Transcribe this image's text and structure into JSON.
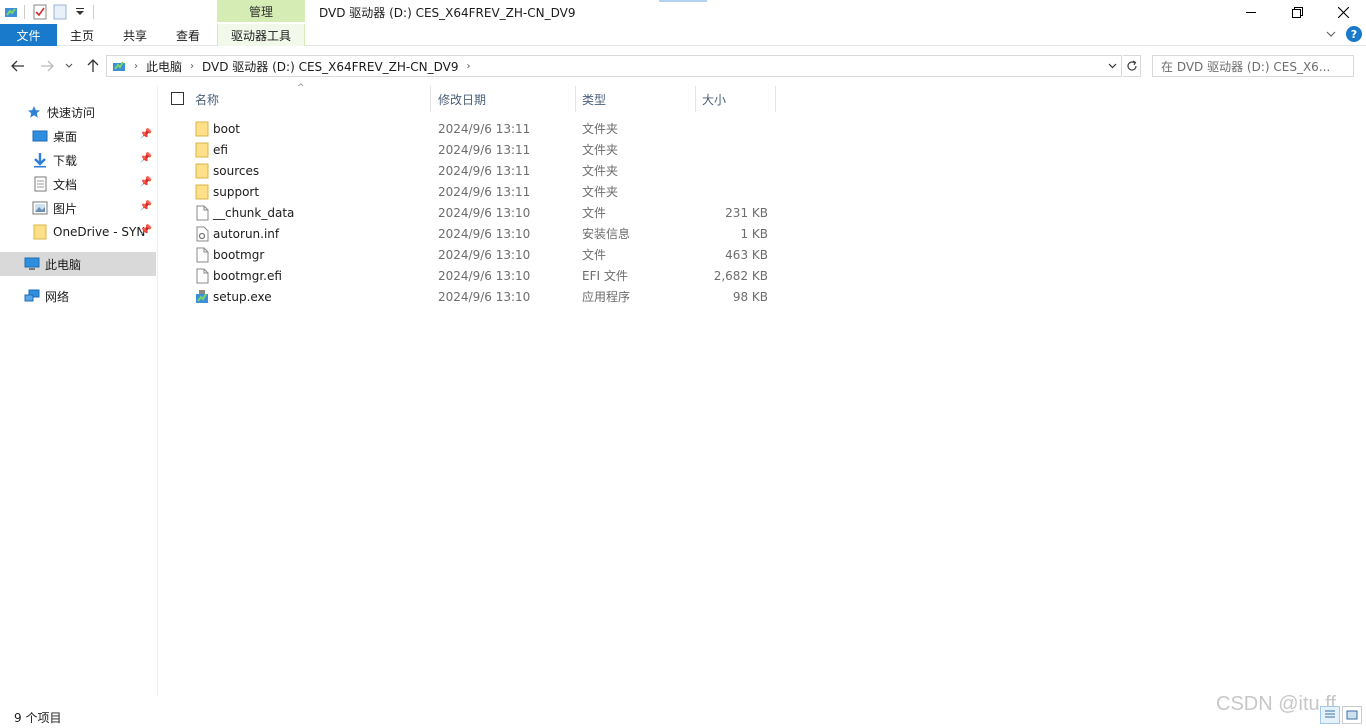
{
  "window": {
    "title": "DVD 驱动器 (D:) CES_X64FREV_ZH-CN_DV9",
    "contextual_tab_group": "管理",
    "controls": {
      "minimize": "—",
      "maximize": "❐",
      "close": "✕"
    }
  },
  "quick_access_toolbar": {
    "items": [
      "properties-icon",
      "checklist-icon",
      "new-folder-icon",
      "customize-dropdown-icon"
    ]
  },
  "ribbon": {
    "tabs": [
      {
        "label": "文件",
        "active": true
      },
      {
        "label": "主页"
      },
      {
        "label": "共享"
      },
      {
        "label": "查看"
      },
      {
        "label": "驱动器工具",
        "contextual": true
      }
    ],
    "accent_color": "#1979ca",
    "contextual_color": "#d6ecb5"
  },
  "address_bar": {
    "breadcrumbs": [
      "此电脑",
      "DVD 驱动器 (D:) CES_X64FREV_ZH-CN_DV9"
    ],
    "search_placeholder": "在 DVD 驱动器 (D:) CES_X6..."
  },
  "nav_pane": {
    "items": [
      {
        "label": "快速访问",
        "icon": "star-icon"
      },
      {
        "label": "桌面",
        "icon": "desktop-icon",
        "pinned": true
      },
      {
        "label": "下载",
        "icon": "download-icon",
        "pinned": true
      },
      {
        "label": "文档",
        "icon": "document-icon",
        "pinned": true
      },
      {
        "label": "图片",
        "icon": "picture-icon",
        "pinned": true
      },
      {
        "label": "OneDrive - SYN",
        "icon": "folder-icon",
        "pinned": true
      },
      {
        "label": "此电脑",
        "icon": "computer-icon",
        "selected": true
      },
      {
        "label": "网络",
        "icon": "network-icon"
      }
    ]
  },
  "file_list": {
    "columns": [
      "名称",
      "修改日期",
      "类型",
      "大小"
    ],
    "rows": [
      {
        "name": "boot",
        "date": "2024/9/6 13:11",
        "type": "文件夹",
        "size": "",
        "icon": "folder-icon"
      },
      {
        "name": "efi",
        "date": "2024/9/6 13:11",
        "type": "文件夹",
        "size": "",
        "icon": "folder-icon"
      },
      {
        "name": "sources",
        "date": "2024/9/6 13:11",
        "type": "文件夹",
        "size": "",
        "icon": "folder-icon"
      },
      {
        "name": "support",
        "date": "2024/9/6 13:11",
        "type": "文件夹",
        "size": "",
        "icon": "folder-icon"
      },
      {
        "name": "__chunk_data",
        "date": "2024/9/6 13:10",
        "type": "文件",
        "size": "231 KB",
        "icon": "file-icon"
      },
      {
        "name": "autorun.inf",
        "date": "2024/9/6 13:10",
        "type": "安装信息",
        "size": "1 KB",
        "icon": "settings-file-icon"
      },
      {
        "name": "bootmgr",
        "date": "2024/9/6 13:10",
        "type": "文件",
        "size": "463 KB",
        "icon": "file-icon"
      },
      {
        "name": "bootmgr.efi",
        "date": "2024/9/6 13:10",
        "type": "EFI 文件",
        "size": "2,682 KB",
        "icon": "file-icon"
      },
      {
        "name": "setup.exe",
        "date": "2024/9/6 13:10",
        "type": "应用程序",
        "size": "98 KB",
        "icon": "setup-icon"
      }
    ]
  },
  "status_bar": {
    "item_count": "9 个项目"
  },
  "watermark": "CSDN @itu.ff"
}
